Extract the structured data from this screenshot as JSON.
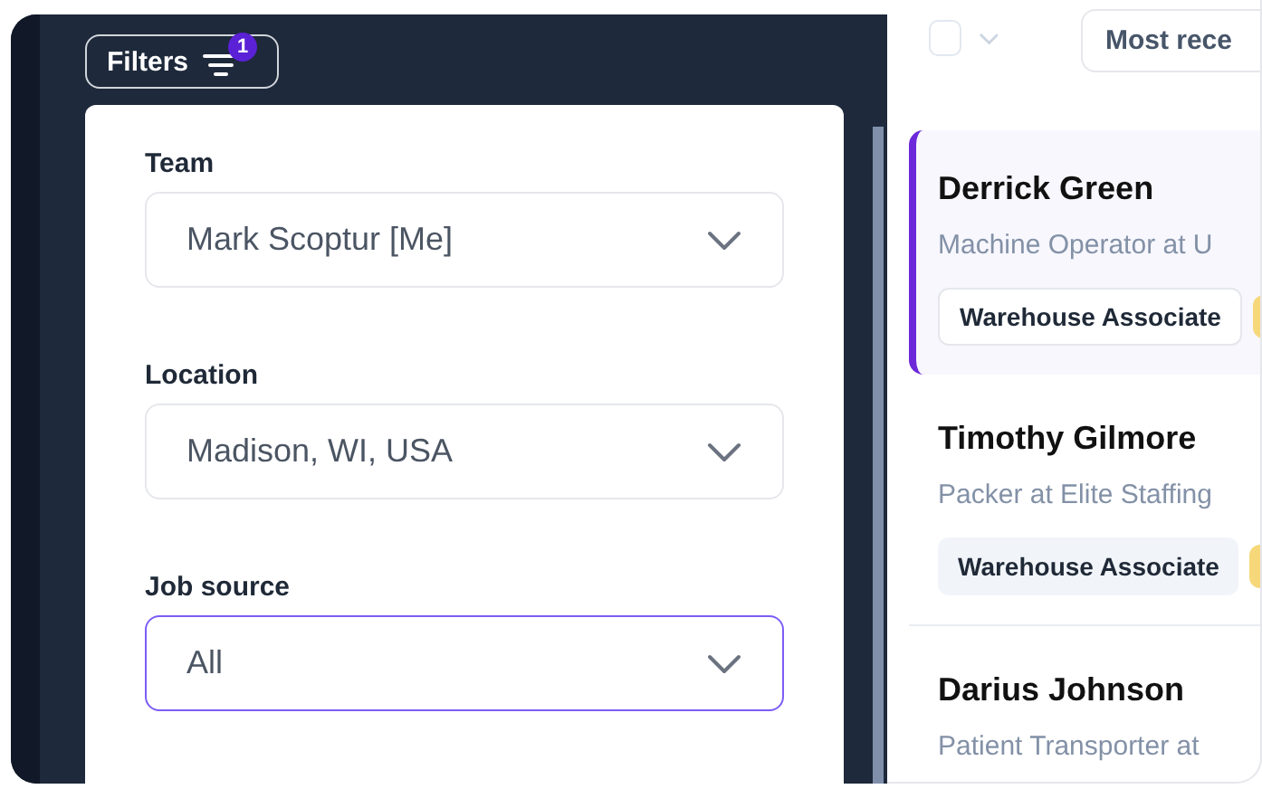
{
  "filters_button": {
    "label": "Filters",
    "badge": "1"
  },
  "filter_fields": [
    {
      "label": "Team",
      "value": "Mark Scoptur [Me]",
      "focused": false
    },
    {
      "label": "Location",
      "value": "Madison, WI, USA",
      "focused": false
    },
    {
      "label": "Job source",
      "value": "All",
      "focused": true
    }
  ],
  "list_toolbar": {
    "select_all_checked": false,
    "sort": "Most rece"
  },
  "candidates": [
    {
      "name": "Derrick Green",
      "title": "Machine Operator at U",
      "tag": "Warehouse Associate",
      "selected": true
    },
    {
      "name": "Timothy Gilmore",
      "title": "Packer at Elite Staffing",
      "tag": "Warehouse Associate",
      "selected": false
    },
    {
      "name": "Darius Johnson",
      "title": "Patient Transporter at",
      "selected": false
    }
  ]
}
